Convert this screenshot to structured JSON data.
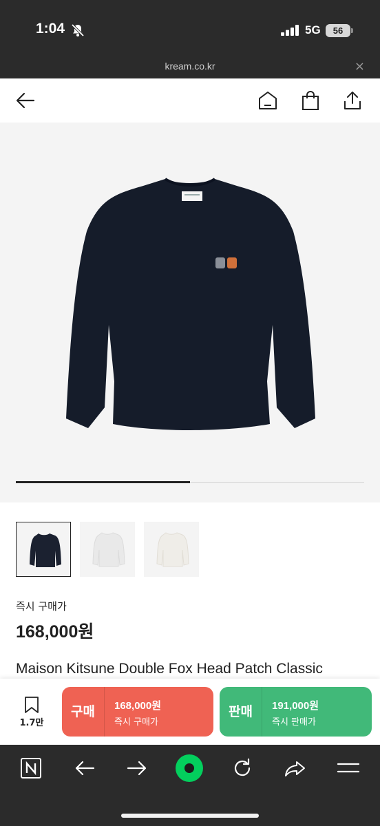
{
  "status_bar": {
    "time": "1:04",
    "network": "5G",
    "battery": "56"
  },
  "url_bar": {
    "url": "kream.co.kr",
    "close": "×"
  },
  "header": {
    "icons": [
      "back-arrow-icon",
      "home-icon",
      "shopping-bag-icon",
      "share-icon"
    ]
  },
  "gallery": {
    "progress": 0.5,
    "thumbnail_count": 3,
    "selected_index": 0,
    "thumbnail_colors": [
      "#1b2130",
      "#e9e9e9",
      "#efede8"
    ]
  },
  "price": {
    "label": "즉시 구매가",
    "value": "168,000원"
  },
  "product": {
    "name": "Maison Kitsune Double Fox Head Patch Classic"
  },
  "actions": {
    "wish_count": "1.7만",
    "buy": {
      "label": "구매",
      "price": "168,000원",
      "sub": "즉시 구매가",
      "color": "#ef6253"
    },
    "sell": {
      "label": "판매",
      "price": "191,000원",
      "sub": "즉시 판매가",
      "color": "#41b979"
    }
  },
  "browser_toolbar": {
    "icons": [
      "naver-n-icon",
      "back-icon",
      "forward-icon",
      "green-dot-icon",
      "refresh-icon",
      "share-icon",
      "menu-icon"
    ],
    "accent": "#03cf5d"
  }
}
